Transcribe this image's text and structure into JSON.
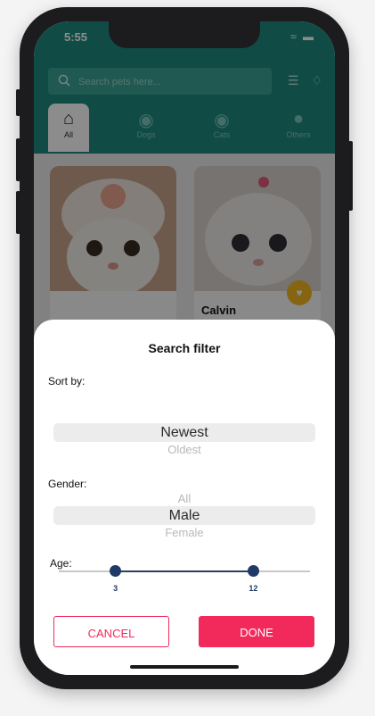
{
  "status_bar": {
    "time": "5:55",
    "icons": "wifi battery"
  },
  "search": {
    "placeholder": "Search pets here..."
  },
  "categories": [
    {
      "label": "All",
      "icon": "house-icon"
    },
    {
      "label": "Dogs",
      "icon": "dog-icon"
    },
    {
      "label": "Cats",
      "icon": "cat-icon"
    },
    {
      "label": "Others",
      "icon": "paw-icon"
    }
  ],
  "cards": [
    {
      "name": ""
    },
    {
      "name": "Calvin"
    }
  ],
  "sheet": {
    "title": "Search filter",
    "sort_label": "Sort by:",
    "sort_options": {
      "selected": "Newest",
      "next": "Oldest"
    },
    "gender_label": "Gender:",
    "gender_options": {
      "prev": "All",
      "selected": "Male",
      "next": "Female"
    },
    "age_label": "Age:",
    "age_min": 3,
    "age_max": 12,
    "age_min_label": "3",
    "age_max_label": "12",
    "cancel_label": "CANCEL",
    "done_label": "DONE"
  },
  "colors": {
    "accent": "#f2295b",
    "slider": "#1f3a66",
    "header": "#1e8a7e",
    "favorite": "#f2b722"
  }
}
